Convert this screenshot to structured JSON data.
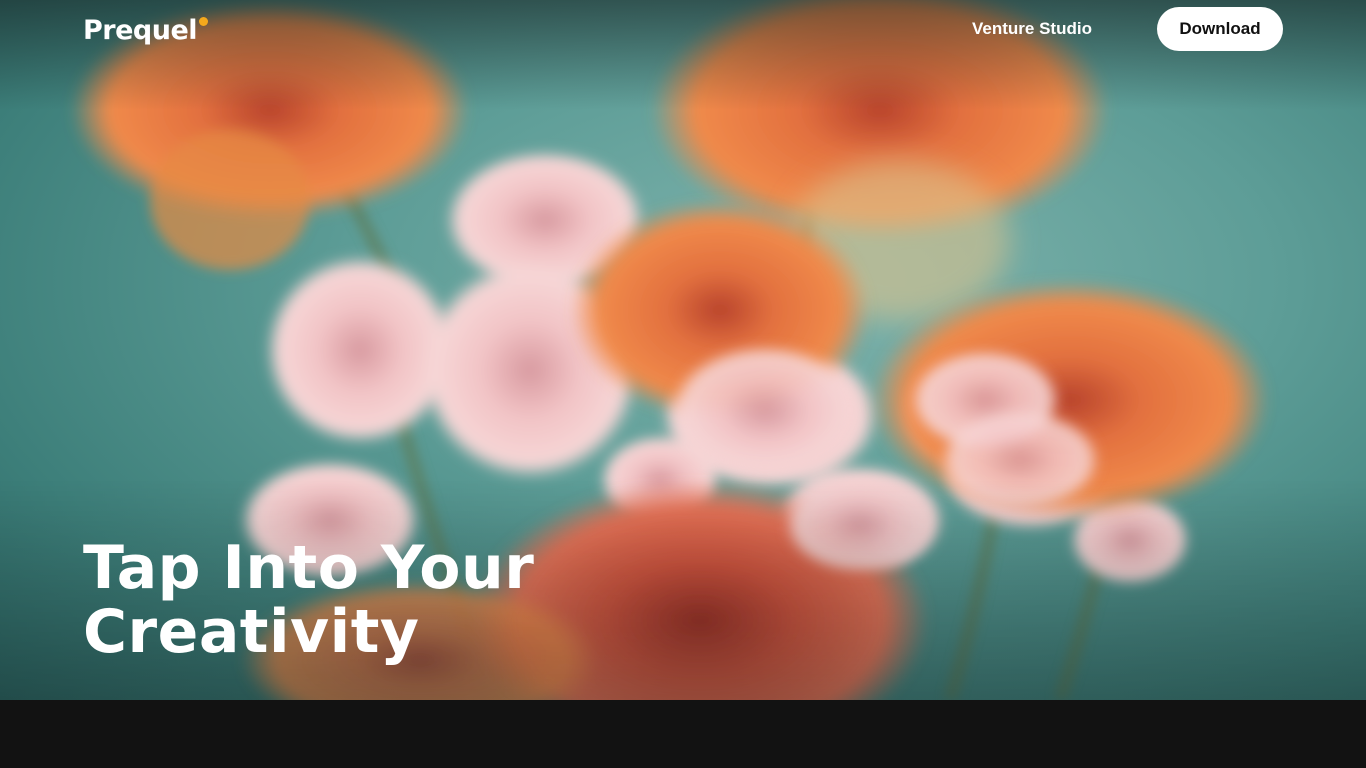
{
  "header": {
    "logo_text": "Prequel",
    "logo_dot_color": "#f4a81c",
    "nav_link": "Venture Studio",
    "cta_label": "Download"
  },
  "hero": {
    "headline_line1": "Tap Into Your",
    "headline_line2": "Creativity",
    "background_image": "bouquet of orange gerbera daisies and pink chrysanthemums on teal background"
  }
}
